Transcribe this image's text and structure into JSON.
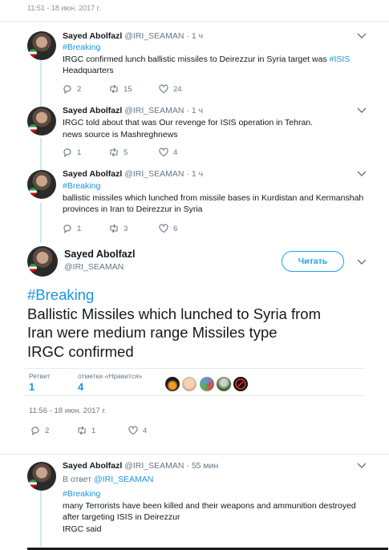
{
  "top_timestamp": "11:51 - 18 июн. 2017 г.",
  "tweets": [
    {
      "name": "Sayed Abolfazl",
      "handle": "@IRI_SEAMAN",
      "time": "· 1 ч",
      "lines": [
        "#Breaking",
        "IRGC confirmed lunch ballistic missiles to Deirezzur in Syria target was #ISIS",
        "Headquarters"
      ],
      "replies": "2",
      "retweets": "15",
      "likes": "24"
    },
    {
      "name": "Sayed Abolfazl",
      "handle": "@IRI_SEAMAN",
      "time": "· 1 ч",
      "lines": [
        "IRGC told about that was Our revenge for ISIS operation in Tehran.",
        "news source is Mashreghnews"
      ],
      "replies": "1",
      "retweets": "5",
      "likes": "4"
    },
    {
      "name": "Sayed Abolfazl",
      "handle": "@IRI_SEAMAN",
      "time": "· 1 ч",
      "lines": [
        "#Breaking",
        "ballistic missiles which lunched from missile bases in  Kurdistan and Kermanshah",
        "provinces in Iran to Deirezzur in Syria"
      ],
      "replies": "1",
      "retweets": "3",
      "likes": "6"
    }
  ],
  "main_tweet": {
    "name": "Sayed Abolfazl",
    "handle": "@IRI_SEAMAN",
    "follow_label": "Читать",
    "hashtag": "#Breaking",
    "text_lines": [
      "Ballistic Missiles which lunched to Syria from",
      "Iran were medium range Missiles type",
      "IRGC confirmed"
    ],
    "retweets_label": "Ретвит",
    "retweets_count": "1",
    "likes_label": "отметки «Нравится»",
    "likes_count": "4",
    "timestamp": "11:56 - 18 июн. 2017 г.",
    "replies": "2",
    "retweets": "1",
    "likes": "4"
  },
  "reply_tweet": {
    "name": "Sayed Abolfazl",
    "handle": "@IRI_SEAMAN",
    "time": "· 55 мин",
    "reply_prefix": "В ответ",
    "reply_to": "@IRI_SEAMAN",
    "lines": [
      "#Breaking",
      "many Terrorists have been killed and their weapons and ammunition destroyed",
      "after targeting ISIS in Deirezzur",
      "IRGC said"
    ]
  },
  "colors": {
    "accent": "#1da1f2",
    "link": "#1b95e0",
    "muted": "#657786",
    "thread": "#cfe6f7"
  }
}
